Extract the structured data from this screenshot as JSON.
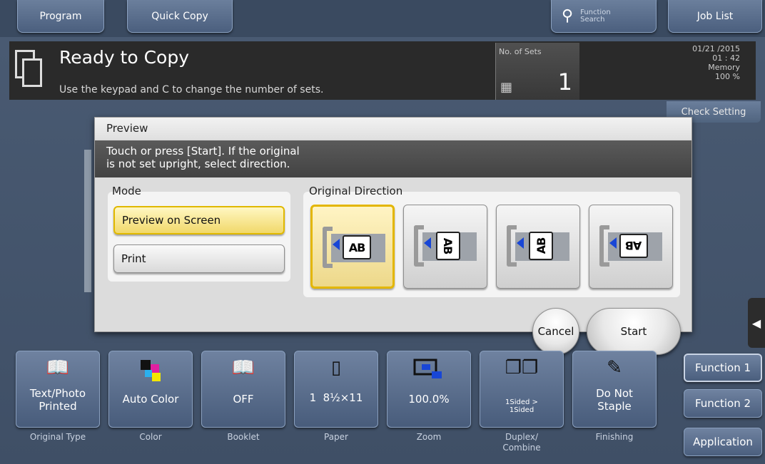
{
  "topbar": {
    "tabs": [
      {
        "label": "Program"
      },
      {
        "label": "Quick Copy"
      }
    ],
    "function_search_label": "Function\nSearch",
    "job_list_label": "Job List"
  },
  "status": {
    "title": "Ready to Copy",
    "subtitle": "Use the keypad and C to change the number of sets.",
    "sets_label": "No. of Sets",
    "sets_value": "1",
    "date": "01/21 /2015",
    "time": "01 : 42",
    "memory_label": "Memory",
    "memory_value": "100 %",
    "check_setting_label": "Check Setting"
  },
  "dialog": {
    "title": "Preview",
    "message_line1": "Touch or press [Start]. If the original",
    "message_line2": "is not set upright, select direction.",
    "mode_label": "Mode",
    "mode_options": [
      {
        "label": "Preview on Screen",
        "selected": true
      },
      {
        "label": "Print",
        "selected": false
      }
    ],
    "direction_label": "Original Direction",
    "direction_options": [
      {
        "text": "AB",
        "rotation": 0,
        "selected": true
      },
      {
        "text": "AB",
        "rotation": 90,
        "selected": false
      },
      {
        "text": "AB",
        "rotation": -90,
        "selected": false
      },
      {
        "text": "AB",
        "rotation": 180,
        "selected": false
      }
    ],
    "cancel_label": "Cancel",
    "start_label": "Start"
  },
  "functions": [
    {
      "value": "Text/Photo\nPrinted",
      "label": "Original Type",
      "icon": "book-icon"
    },
    {
      "value": "Auto Color",
      "label": "Color",
      "icon": "color-icon"
    },
    {
      "value": "OFF",
      "label": "Booklet",
      "icon": "booklet-icon"
    },
    {
      "value": "1  8½×11",
      "label": "Paper",
      "icon": "paper-icon"
    },
    {
      "value": "100.0%",
      "label": "Zoom",
      "icon": "zoom-icon"
    },
    {
      "value": "1Sided >\n1Sided",
      "label": "Duplex/\nCombine",
      "icon": "duplex-icon"
    },
    {
      "value": "Do Not\nStaple",
      "label": "Finishing",
      "icon": "staple-icon"
    }
  ],
  "side_menu": {
    "function1_label": "Function 1",
    "function2_label": "Function 2",
    "application_label": "Application"
  }
}
